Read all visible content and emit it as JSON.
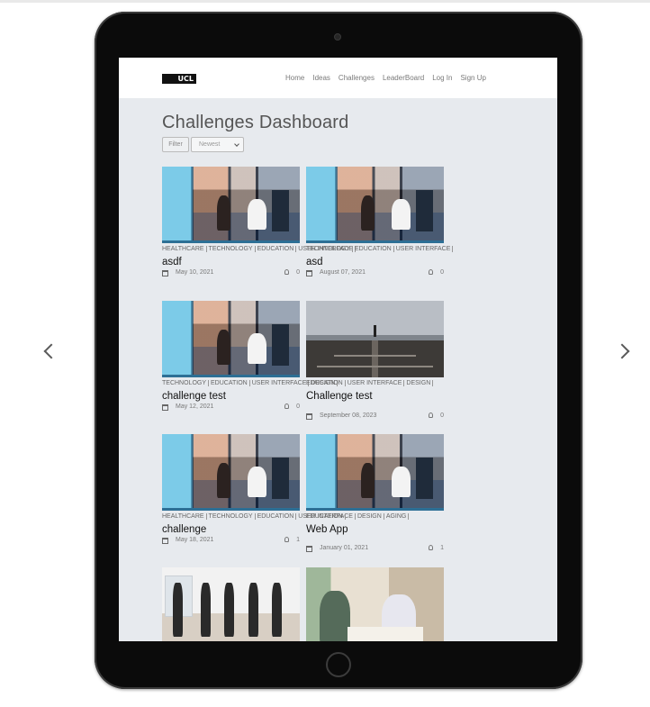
{
  "nav": {
    "logo": "UCL",
    "links": [
      "Home",
      "Ideas",
      "Challenges",
      "LeaderBoard",
      "Log In",
      "Sign Up"
    ]
  },
  "page": {
    "title": "Challenges Dashboard",
    "filter_label": "Filter",
    "sort_value": "Newest"
  },
  "cards": [
    {
      "tags": [
        "HEALTHCARE",
        "TECHNOLOGY",
        "EDUCATION",
        "USER INTERFACE"
      ],
      "title": "asdf",
      "date": "May 10, 2021",
      "count": "0",
      "image": "office"
    },
    {
      "tags": [
        "TECHNOLOGY",
        "EDUCATION",
        "USER INTERFACE"
      ],
      "title": "asd",
      "date": "August 07, 2021",
      "count": "0",
      "image": "office"
    },
    {
      "tags": [
        "TECHNOLOGY",
        "EDUCATION",
        "USER INTERFACE",
        "DESIGN"
      ],
      "title": "challenge test",
      "date": "May 12, 2021",
      "count": "0",
      "image": "office"
    },
    {
      "tags": [
        "EDUCATION",
        "USER INTERFACE",
        "DESIGN"
      ],
      "title": "Challenge test",
      "date": "September 08, 2023",
      "count": "0",
      "image": "railway"
    },
    {
      "tags": [
        "HEALTHCARE",
        "TECHNOLOGY",
        "EDUCATION",
        "USER INTERFACE",
        "DESIGN",
        "AGING"
      ],
      "title": "challenge",
      "date": "May 18, 2021",
      "count": "1",
      "image": "office"
    },
    {
      "tags": [
        "EDUCATION"
      ],
      "title": "Web App",
      "date": "January 01, 2021",
      "count": "1",
      "image": "office"
    },
    {
      "image": "fitness"
    },
    {
      "image": "elderly-care"
    }
  ],
  "icons": [
    "chevron-left-icon",
    "chevron-right-icon",
    "calendar-icon",
    "lightbulb-icon"
  ]
}
